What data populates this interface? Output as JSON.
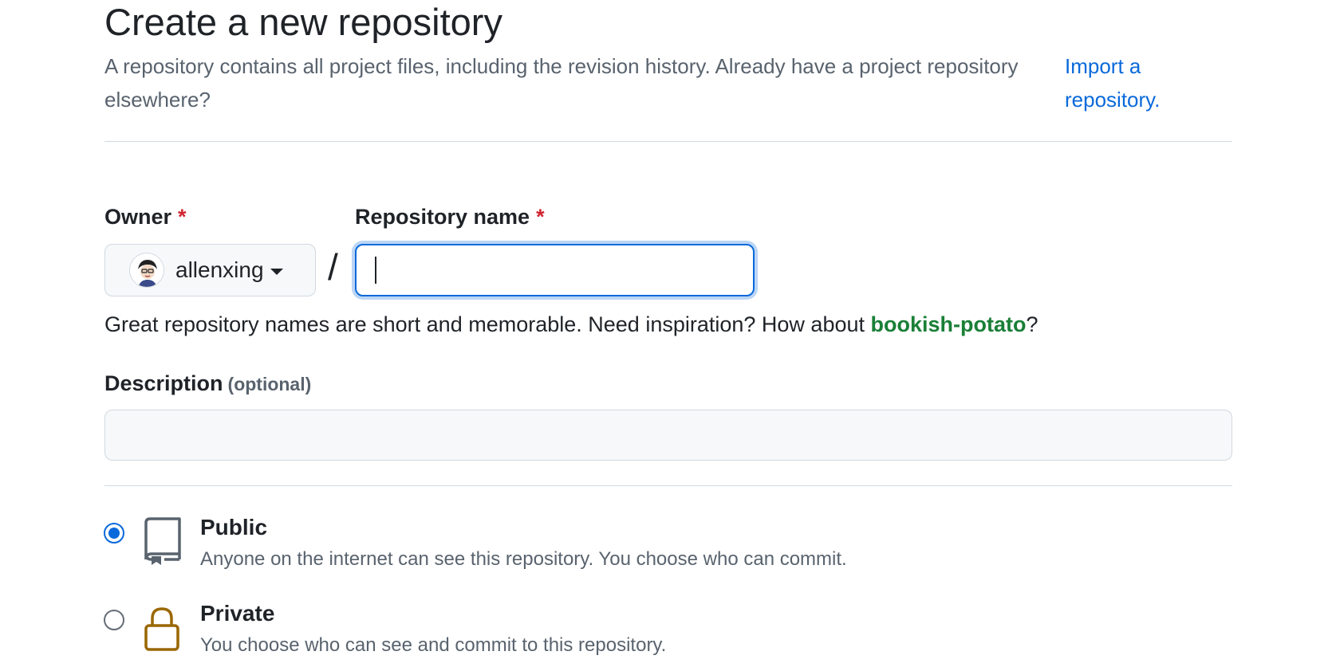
{
  "header": {
    "title": "Create a new repository",
    "intro": "A repository contains all project files, including the revision history. Already have a project repository elsewhere?",
    "import_link": "Import a repository."
  },
  "form": {
    "owner": {
      "label": "Owner",
      "required_mark": "*",
      "value": "allenxing"
    },
    "separator": "/",
    "repo_name": {
      "label": "Repository name",
      "required_mark": "*",
      "value": ""
    },
    "hint": {
      "prefix": "Great repository names are short and memorable. Need inspiration? How about ",
      "suggestion": "bookish-potato",
      "suffix": "?"
    },
    "description": {
      "label": "Description",
      "optional": "(optional)",
      "value": ""
    },
    "visibility": {
      "selected": "public",
      "options": [
        {
          "id": "public",
          "title": "Public",
          "description": "Anyone on the internet can see this repository. You choose who can commit.",
          "icon": "repo-icon"
        },
        {
          "id": "private",
          "title": "Private",
          "description": "You choose who can see and commit to this repository.",
          "icon": "lock-icon"
        }
      ]
    }
  },
  "colors": {
    "accent": "#0969da",
    "required": "#d1242f",
    "suggestion": "#1a7f37",
    "lock": "#9a6700",
    "muted": "#59636e"
  }
}
